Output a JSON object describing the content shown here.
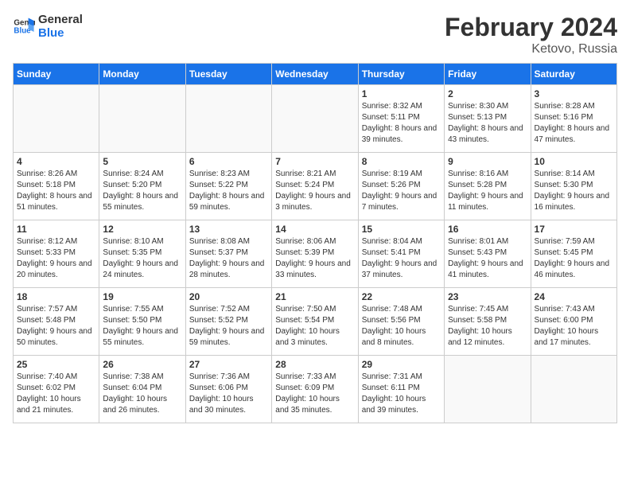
{
  "header": {
    "logo_line1": "General",
    "logo_line2": "Blue",
    "title": "February 2024",
    "subtitle": "Ketovo, Russia"
  },
  "days_of_week": [
    "Sunday",
    "Monday",
    "Tuesday",
    "Wednesday",
    "Thursday",
    "Friday",
    "Saturday"
  ],
  "weeks": [
    [
      {
        "day": "",
        "info": ""
      },
      {
        "day": "",
        "info": ""
      },
      {
        "day": "",
        "info": ""
      },
      {
        "day": "",
        "info": ""
      },
      {
        "day": "1",
        "info": "Sunrise: 8:32 AM\nSunset: 5:11 PM\nDaylight: 8 hours and 39 minutes."
      },
      {
        "day": "2",
        "info": "Sunrise: 8:30 AM\nSunset: 5:13 PM\nDaylight: 8 hours and 43 minutes."
      },
      {
        "day": "3",
        "info": "Sunrise: 8:28 AM\nSunset: 5:16 PM\nDaylight: 8 hours and 47 minutes."
      }
    ],
    [
      {
        "day": "4",
        "info": "Sunrise: 8:26 AM\nSunset: 5:18 PM\nDaylight: 8 hours and 51 minutes."
      },
      {
        "day": "5",
        "info": "Sunrise: 8:24 AM\nSunset: 5:20 PM\nDaylight: 8 hours and 55 minutes."
      },
      {
        "day": "6",
        "info": "Sunrise: 8:23 AM\nSunset: 5:22 PM\nDaylight: 8 hours and 59 minutes."
      },
      {
        "day": "7",
        "info": "Sunrise: 8:21 AM\nSunset: 5:24 PM\nDaylight: 9 hours and 3 minutes."
      },
      {
        "day": "8",
        "info": "Sunrise: 8:19 AM\nSunset: 5:26 PM\nDaylight: 9 hours and 7 minutes."
      },
      {
        "day": "9",
        "info": "Sunrise: 8:16 AM\nSunset: 5:28 PM\nDaylight: 9 hours and 11 minutes."
      },
      {
        "day": "10",
        "info": "Sunrise: 8:14 AM\nSunset: 5:30 PM\nDaylight: 9 hours and 16 minutes."
      }
    ],
    [
      {
        "day": "11",
        "info": "Sunrise: 8:12 AM\nSunset: 5:33 PM\nDaylight: 9 hours and 20 minutes."
      },
      {
        "day": "12",
        "info": "Sunrise: 8:10 AM\nSunset: 5:35 PM\nDaylight: 9 hours and 24 minutes."
      },
      {
        "day": "13",
        "info": "Sunrise: 8:08 AM\nSunset: 5:37 PM\nDaylight: 9 hours and 28 minutes."
      },
      {
        "day": "14",
        "info": "Sunrise: 8:06 AM\nSunset: 5:39 PM\nDaylight: 9 hours and 33 minutes."
      },
      {
        "day": "15",
        "info": "Sunrise: 8:04 AM\nSunset: 5:41 PM\nDaylight: 9 hours and 37 minutes."
      },
      {
        "day": "16",
        "info": "Sunrise: 8:01 AM\nSunset: 5:43 PM\nDaylight: 9 hours and 41 minutes."
      },
      {
        "day": "17",
        "info": "Sunrise: 7:59 AM\nSunset: 5:45 PM\nDaylight: 9 hours and 46 minutes."
      }
    ],
    [
      {
        "day": "18",
        "info": "Sunrise: 7:57 AM\nSunset: 5:48 PM\nDaylight: 9 hours and 50 minutes."
      },
      {
        "day": "19",
        "info": "Sunrise: 7:55 AM\nSunset: 5:50 PM\nDaylight: 9 hours and 55 minutes."
      },
      {
        "day": "20",
        "info": "Sunrise: 7:52 AM\nSunset: 5:52 PM\nDaylight: 9 hours and 59 minutes."
      },
      {
        "day": "21",
        "info": "Sunrise: 7:50 AM\nSunset: 5:54 PM\nDaylight: 10 hours and 3 minutes."
      },
      {
        "day": "22",
        "info": "Sunrise: 7:48 AM\nSunset: 5:56 PM\nDaylight: 10 hours and 8 minutes."
      },
      {
        "day": "23",
        "info": "Sunrise: 7:45 AM\nSunset: 5:58 PM\nDaylight: 10 hours and 12 minutes."
      },
      {
        "day": "24",
        "info": "Sunrise: 7:43 AM\nSunset: 6:00 PM\nDaylight: 10 hours and 17 minutes."
      }
    ],
    [
      {
        "day": "25",
        "info": "Sunrise: 7:40 AM\nSunset: 6:02 PM\nDaylight: 10 hours and 21 minutes."
      },
      {
        "day": "26",
        "info": "Sunrise: 7:38 AM\nSunset: 6:04 PM\nDaylight: 10 hours and 26 minutes."
      },
      {
        "day": "27",
        "info": "Sunrise: 7:36 AM\nSunset: 6:06 PM\nDaylight: 10 hours and 30 minutes."
      },
      {
        "day": "28",
        "info": "Sunrise: 7:33 AM\nSunset: 6:09 PM\nDaylight: 10 hours and 35 minutes."
      },
      {
        "day": "29",
        "info": "Sunrise: 7:31 AM\nSunset: 6:11 PM\nDaylight: 10 hours and 39 minutes."
      },
      {
        "day": "",
        "info": ""
      },
      {
        "day": "",
        "info": ""
      }
    ]
  ]
}
